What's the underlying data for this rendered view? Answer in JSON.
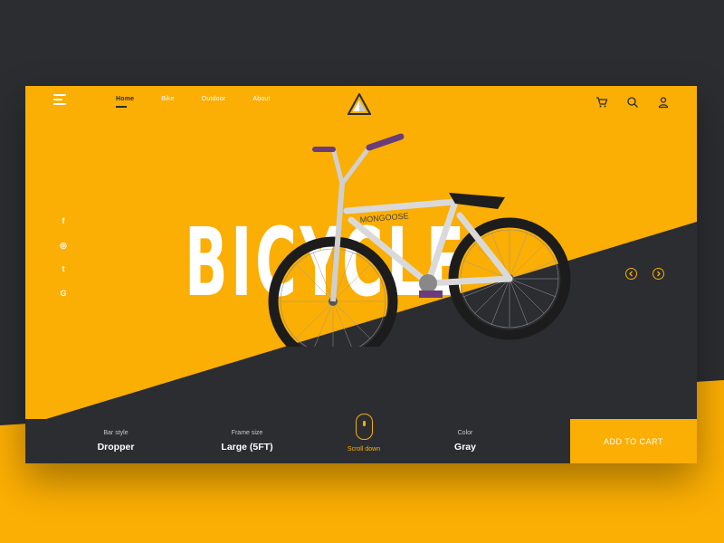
{
  "nav": {
    "links": [
      {
        "label": "Home",
        "active": true
      },
      {
        "label": "Bike"
      },
      {
        "label": "Outdoor"
      },
      {
        "label": "About"
      }
    ]
  },
  "social": [
    "f",
    "◎",
    "t",
    "G"
  ],
  "hero": {
    "title": "BICYCLE"
  },
  "specs": [
    {
      "label": "Bar style",
      "value": "Dropper"
    },
    {
      "label": "Frame size",
      "value": "Large (5FT)"
    },
    {
      "label": "Color",
      "value": "Gray"
    }
  ],
  "scroll": {
    "label": "Scroll down"
  },
  "cart": {
    "label": "ADD TO CART"
  },
  "colors": {
    "accent": "#fbae03",
    "dark": "#2b2d31"
  },
  "icons": [
    "menu-icon",
    "logo-icon",
    "cart-icon",
    "search-icon",
    "user-icon",
    "prev-arrow-icon",
    "next-arrow-icon",
    "mouse-icon"
  ]
}
